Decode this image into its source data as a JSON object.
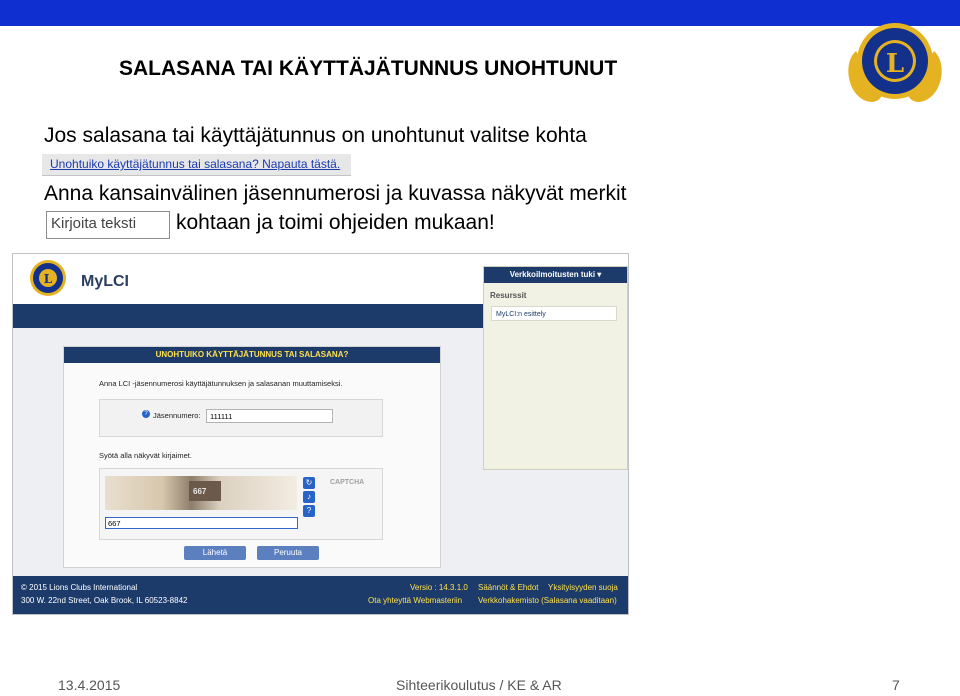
{
  "slide": {
    "title": "SALASANA TAI KÄYTTÄJÄTUNNUS UNOHTUNUT",
    "line1": "Jos salasana tai käyttäjätunnus on unohtunut valitse kohta",
    "link_snippet": "Unohtuiko käyttäjätunnus tai salasana? Napauta tästä.",
    "line2": "Anna kansainvälinen jäsennumerosi  ja kuvassa näkyvät merkit",
    "input_snippet": "Kirjoita teksti",
    "line3": "kohtaan ja toimi ohjeiden mukaan!",
    "footer_date": "13.4.2015",
    "footer_center": "Sihteerikoulutus / KE & AR",
    "footer_page": "7",
    "accent_color": "#0f2fd0"
  },
  "screenshot": {
    "app_name": "MyLCI",
    "sidebar_header": "Verkkoilmoitusten tuki  ▾",
    "sidebar_resources": "Resurssit",
    "sidebar_link": "MyLCI:n esittely",
    "panel_title": "UNOHTUIKO KÄYTTÄJÄTUNNUS TAI SALASANA?",
    "panel_intro": "Anna LCI -jäsennumerosi käyttäjätunnuksen ja salasanan muuttamiseksi.",
    "member_label": "Jäsennumero:",
    "member_value": "111111",
    "captcha_intro": "Syötä alla näkyvät kirjaimet.",
    "captcha_image_text": "667",
    "captcha_value": "667",
    "captcha_brand": "CAPTCHA",
    "submit_label": "Lähetä",
    "cancel_label": "Peruuta",
    "footer_copyright": "© 2015 Lions Clubs International",
    "footer_address": "300 W. 22nd Street, Oak Brook, IL 60523-8842",
    "footer_version": "Versio : 14.3.1.0",
    "footer_rules": "Säännöt & Ehdot",
    "footer_privacy": "Yksityisyyden suoja",
    "footer_webmaster": "Ota yhteyttä Webmasteriin",
    "footer_support": "Verkkohakemisto (Salasana vaaditaan)"
  }
}
